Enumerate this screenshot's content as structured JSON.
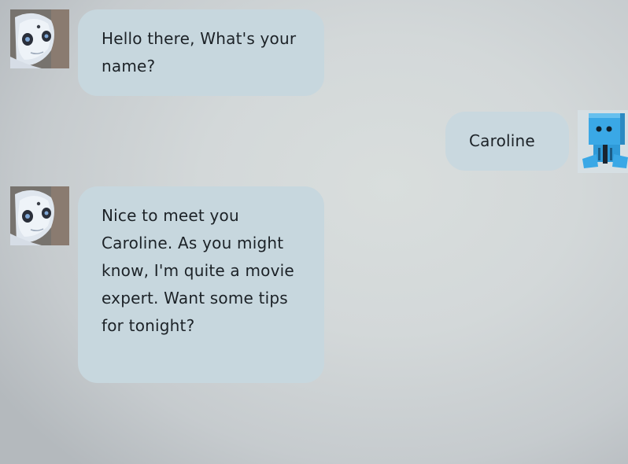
{
  "messages": [
    {
      "sender": "bot",
      "avatar_icon": "pepper-robot-avatar-icon",
      "text": "Hello there, What's your name?"
    },
    {
      "sender": "user",
      "avatar_icon": "blue-box-robot-avatar-icon",
      "text": "Caroline"
    },
    {
      "sender": "bot",
      "avatar_icon": "pepper-robot-avatar-icon",
      "text": "Nice to meet you Caroline. As you might know, I'm quite a movie expert. Want some tips for tonight?"
    }
  ],
  "colors": {
    "bubble": "#c7d7de",
    "text": "#1c2227",
    "background": "#d3d8d9",
    "user_robot_blue": "#2d9fe0"
  }
}
